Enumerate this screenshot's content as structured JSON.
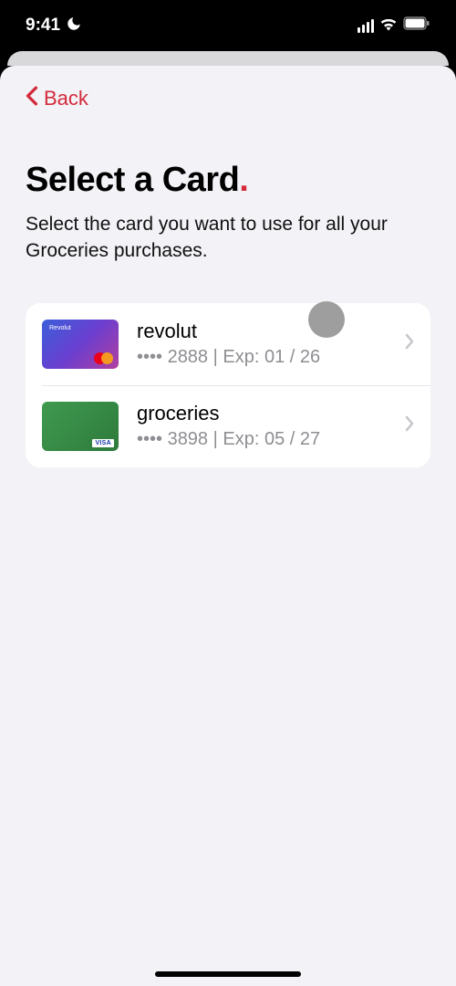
{
  "status": {
    "time": "9:41"
  },
  "nav": {
    "back": "Back"
  },
  "heading": {
    "title": "Select a Card",
    "subtitle": "Select the card you want to use for all your Groceries purchases."
  },
  "cards": [
    {
      "name": "revolut",
      "meta": "•••• 2888 | Exp: 01 / 26",
      "brand": "Revolut"
    },
    {
      "name": "groceries",
      "meta": "•••• 3898 | Exp: 05 / 27",
      "brand": "VISA"
    }
  ]
}
